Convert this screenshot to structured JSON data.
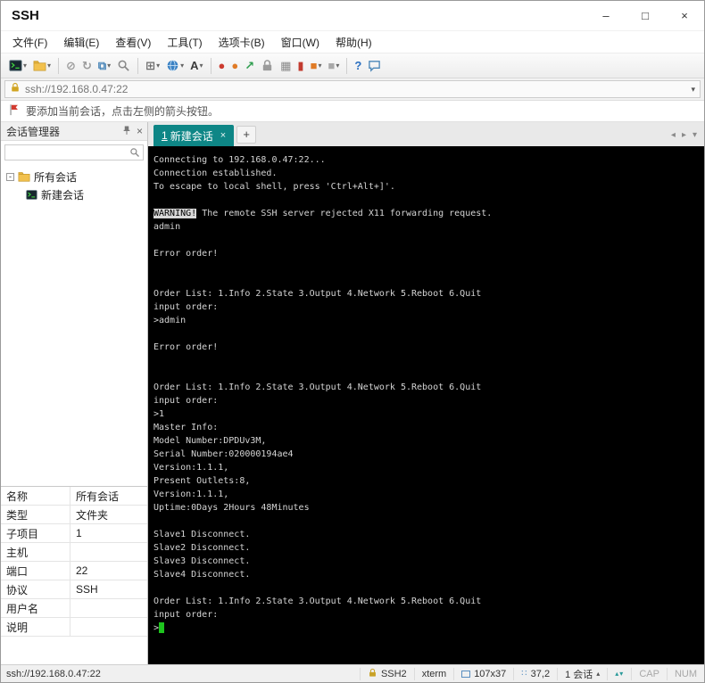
{
  "window": {
    "title": "SSH",
    "minimize": "–",
    "maximize": "□",
    "close": "×"
  },
  "menu": {
    "items": [
      "文件(F)",
      "编辑(E)",
      "查看(V)",
      "工具(T)",
      "选项卡(B)",
      "窗口(W)",
      "帮助(H)"
    ]
  },
  "toolbar": {
    "dropdown_glyph": "▾",
    "icons": [
      {
        "name": "new-session-icon",
        "svg": "terminal",
        "dropdown": true
      },
      {
        "name": "open-folder-icon",
        "svg": "folder",
        "dropdown": true
      },
      {
        "sep": true
      },
      {
        "name": "disconnect-icon",
        "glyph": "⊘",
        "color": "#9b9b9b"
      },
      {
        "name": "reconnect-icon",
        "glyph": "↻",
        "color": "#9b9b9b"
      },
      {
        "name": "duplicate-session-icon",
        "glyph": "⧉",
        "color": "#4a86b8",
        "dropdown": true
      },
      {
        "name": "find-icon",
        "svg": "magnifier"
      },
      {
        "sep": true
      },
      {
        "name": "new-tab-icon",
        "glyph": "⊞",
        "color": "#6b6b6b",
        "dropdown": true
      },
      {
        "name": "web-browser-icon",
        "svg": "globe",
        "dropdown": true
      },
      {
        "name": "font-icon",
        "glyph": "A",
        "color": "#3a3a3a",
        "dropdown": true
      },
      {
        "sep": true
      },
      {
        "name": "log-start-icon",
        "glyph": "●",
        "color": "#cc3b2f"
      },
      {
        "name": "log-pause-icon",
        "glyph": "●",
        "color": "#e07b26"
      },
      {
        "name": "fullscreen-icon",
        "glyph": "↗",
        "color": "#2f9e4f"
      },
      {
        "name": "lock-screen-icon",
        "svg": "lock",
        "color": "#9b9b9b"
      },
      {
        "name": "keyboard-icon",
        "glyph": "▦",
        "color": "#8a8a8a"
      },
      {
        "name": "compose-icon",
        "glyph": "▮",
        "color": "#c23b2f"
      },
      {
        "name": "transfer-icon",
        "glyph": "■",
        "color": "#e07b26",
        "dropdown": true
      },
      {
        "name": "layout-icon",
        "glyph": "■",
        "color": "#a9a9a9",
        "dropdown": true
      },
      {
        "sep": true
      },
      {
        "name": "help-icon",
        "glyph": "?",
        "color": "#2a6fc0"
      },
      {
        "name": "quick-commands-icon",
        "svg": "chat",
        "color": "#4a86b8"
      }
    ]
  },
  "address_bar": {
    "value": "ssh://192.168.0.47:22",
    "dropdown_glyph": "▾"
  },
  "info_bar": {
    "text": "要添加当前会话，点击左侧的箭头按钮。"
  },
  "session_manager": {
    "title": "会话管理器",
    "panel_close_glyph": "×",
    "expander_glyph": "-",
    "tree": [
      {
        "label": "所有会话",
        "type": "folder",
        "level": 0
      },
      {
        "label": "新建会话",
        "type": "session",
        "level": 1
      }
    ],
    "properties": [
      {
        "label": "名称",
        "value": "所有会话"
      },
      {
        "label": "类型",
        "value": "文件夹"
      },
      {
        "label": "子项目",
        "value": "1"
      },
      {
        "label": "主机",
        "value": ""
      },
      {
        "label": "端口",
        "value": "22"
      },
      {
        "label": "协议",
        "value": "SSH"
      },
      {
        "label": "用户名",
        "value": ""
      },
      {
        "label": "说明",
        "value": ""
      }
    ]
  },
  "tab_bar": {
    "active_tab": {
      "index": "1",
      "label": "新建会话",
      "close": "×"
    },
    "new_tab": "+",
    "nav": [
      "◂",
      "▸",
      "▾"
    ]
  },
  "terminal": {
    "lines": [
      {
        "t": "Connecting to 192.168.0.47:22..."
      },
      {
        "t": "Connection established."
      },
      {
        "t": "To escape to local shell, press 'Ctrl+Alt+]'."
      },
      {
        "t": ""
      },
      {
        "seg": [
          {
            "text": "WARNING!",
            "style": "inverse"
          },
          {
            "text": " The remote SSH server rejected X11 forwarding request."
          }
        ]
      },
      {
        "t": "admin"
      },
      {
        "t": ""
      },
      {
        "t": "Error order!"
      },
      {
        "t": ""
      },
      {
        "t": ""
      },
      {
        "t": "Order List: 1.Info 2.State 3.Output 4.Network 5.Reboot 6.Quit"
      },
      {
        "t": "input order:"
      },
      {
        "t": ">admin"
      },
      {
        "t": ""
      },
      {
        "t": "Error order!"
      },
      {
        "t": ""
      },
      {
        "t": ""
      },
      {
        "t": "Order List: 1.Info 2.State 3.Output 4.Network 5.Reboot 6.Quit"
      },
      {
        "t": "input order:"
      },
      {
        "t": ">1"
      },
      {
        "t": "Master Info:"
      },
      {
        "t": "Model Number:DPDUv3M,"
      },
      {
        "t": "Serial Number:020000194ae4"
      },
      {
        "t": "Version:1.1.1,"
      },
      {
        "t": "Present Outlets:8,"
      },
      {
        "t": "Version:1.1.1,"
      },
      {
        "t": "Uptime:0Days 2Hours 48Minutes"
      },
      {
        "t": ""
      },
      {
        "t": "Slave1 Disconnect."
      },
      {
        "t": "Slave2 Disconnect."
      },
      {
        "t": "Slave3 Disconnect."
      },
      {
        "t": "Slave4 Disconnect."
      },
      {
        "t": ""
      },
      {
        "t": "Order List: 1.Info 2.State 3.Output 4.Network 5.Reboot 6.Quit"
      },
      {
        "t": "input order:"
      },
      {
        "t": ">",
        "cursor": true
      }
    ]
  },
  "status_bar": {
    "left": "ssh://192.168.0.47:22",
    "protocol": "SSH2",
    "term_type": "xterm",
    "size": "107x37",
    "position": "37,2",
    "sessions": "1 会话",
    "session_caret": "▴",
    "scroll_arrows": "▴▾",
    "cap": "CAP",
    "num": "NUM",
    "position_icon_glyph": "∷"
  }
}
